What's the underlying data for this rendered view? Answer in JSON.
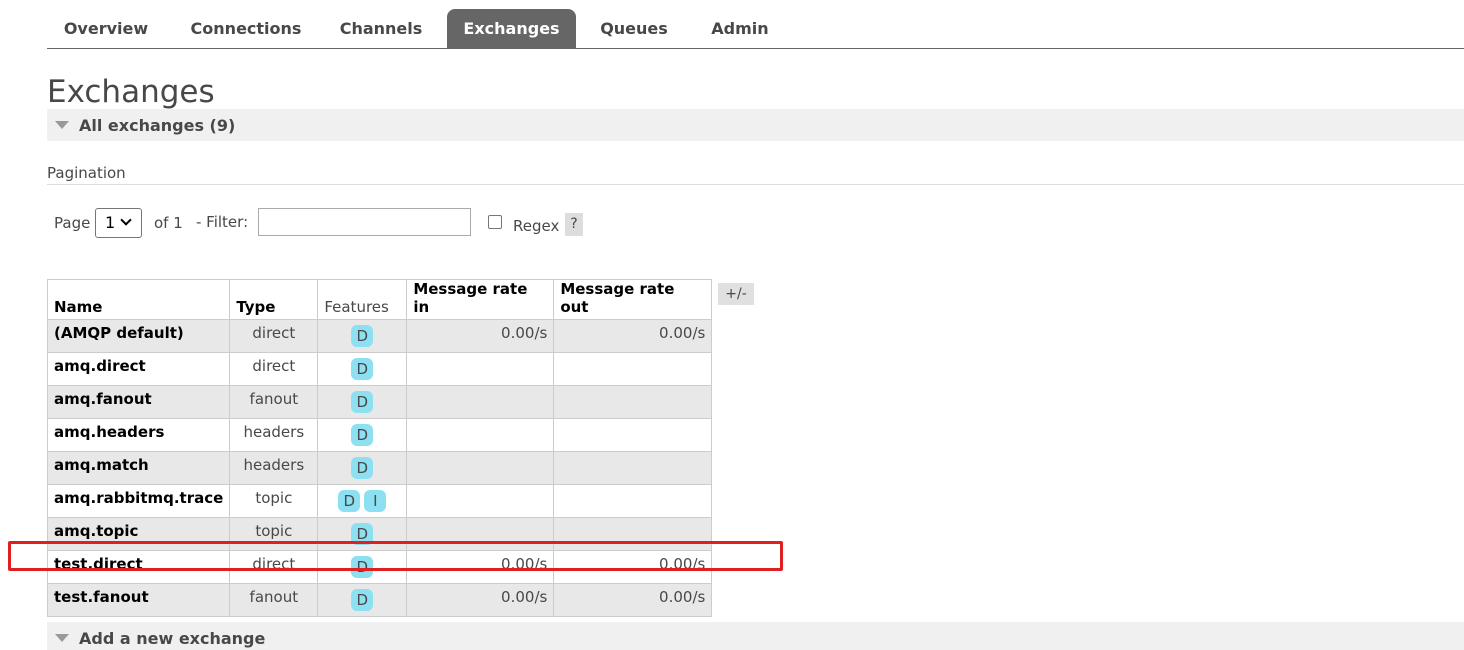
{
  "nav": {
    "tabs": [
      {
        "label": "Overview"
      },
      {
        "label": "Connections"
      },
      {
        "label": "Channels"
      },
      {
        "label": "Exchanges"
      },
      {
        "label": "Queues"
      },
      {
        "label": "Admin"
      }
    ],
    "active": "Exchanges"
  },
  "page_title": "Exchanges",
  "all_section": {
    "label": "All exchanges (9)"
  },
  "pagination": {
    "label": "Pagination",
    "page_label": "Page",
    "page_value": "1",
    "of_label": "of 1",
    "filter_label": "- Filter:",
    "filter_value": "",
    "regex_label": "Regex",
    "help_label": "?"
  },
  "table": {
    "columns": [
      "Name",
      "Type",
      "Features",
      "Message rate in",
      "Message rate out"
    ],
    "toggle_label": "+/-",
    "rows": [
      {
        "name": "(AMQP default)",
        "type": "direct",
        "features": [
          "D"
        ],
        "rate_in": "0.00/s",
        "rate_out": "0.00/s"
      },
      {
        "name": "amq.direct",
        "type": "direct",
        "features": [
          "D"
        ],
        "rate_in": "",
        "rate_out": ""
      },
      {
        "name": "amq.fanout",
        "type": "fanout",
        "features": [
          "D"
        ],
        "rate_in": "",
        "rate_out": ""
      },
      {
        "name": "amq.headers",
        "type": "headers",
        "features": [
          "D"
        ],
        "rate_in": "",
        "rate_out": ""
      },
      {
        "name": "amq.match",
        "type": "headers",
        "features": [
          "D"
        ],
        "rate_in": "",
        "rate_out": ""
      },
      {
        "name": "amq.rabbitmq.trace",
        "type": "topic",
        "features": [
          "D",
          "I"
        ],
        "rate_in": "",
        "rate_out": ""
      },
      {
        "name": "amq.topic",
        "type": "topic",
        "features": [
          "D"
        ],
        "rate_in": "",
        "rate_out": ""
      },
      {
        "name": "test.direct",
        "type": "direct",
        "features": [
          "D"
        ],
        "rate_in": "0.00/s",
        "rate_out": "0.00/s"
      },
      {
        "name": "test.fanout",
        "type": "fanout",
        "features": [
          "D"
        ],
        "rate_in": "0.00/s",
        "rate_out": "0.00/s"
      }
    ]
  },
  "add_section": {
    "label": "Add a new exchange"
  },
  "colors": {
    "accent_tab": "#666666",
    "badge": "#8ce0f2",
    "highlight": "#e02020"
  }
}
